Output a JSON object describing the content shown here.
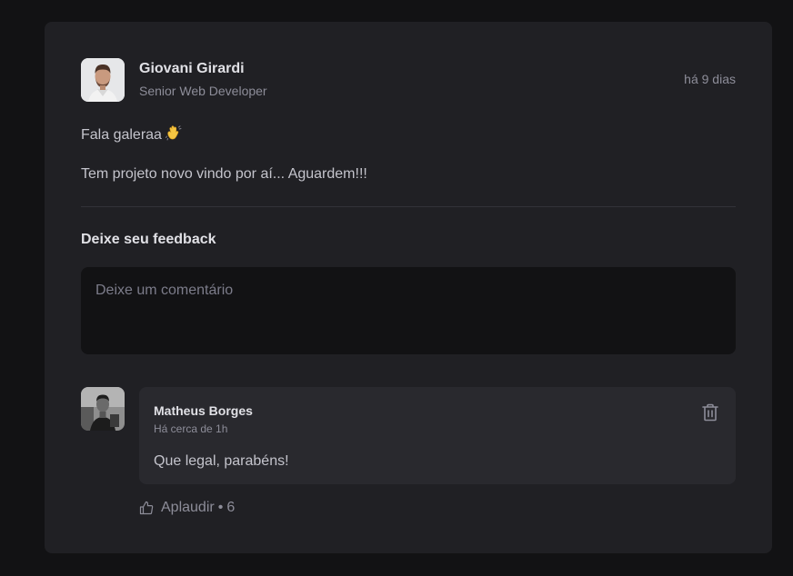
{
  "post": {
    "author": {
      "name": "Giovani Girardi",
      "role": "Senior Web Developer",
      "avatar_icon": "avatar-photo-giovani"
    },
    "published": "há 9 dias",
    "content": {
      "line1": "Fala galeraa",
      "line1_emoji": "waving-hand-icon",
      "line2": "Tem projeto novo vindo por aí... Aguardem!!!"
    }
  },
  "feedback": {
    "title": "Deixe seu feedback",
    "placeholder": "Deixe um comentário",
    "value": ""
  },
  "comments": [
    {
      "author": "Matheus Borges",
      "time": "Há cerca de 1h",
      "text": "Que legal, parabéns!",
      "avatar_icon": "avatar-photo-matheus",
      "delete_icon": "trash-icon",
      "applaud_label": "Aplaudir",
      "applaud_separator": "•",
      "applaud_count": "6",
      "applaud_icon": "thumbs-up-icon"
    }
  ],
  "colors": {
    "page_background": "#121214",
    "card_background": "#202024",
    "comment_background": "#29292e",
    "input_background": "#121214",
    "heading_text": "#e1e1e6",
    "body_text": "#c4c4cc",
    "muted_text": "#8d8d99",
    "divider": "#323238"
  }
}
